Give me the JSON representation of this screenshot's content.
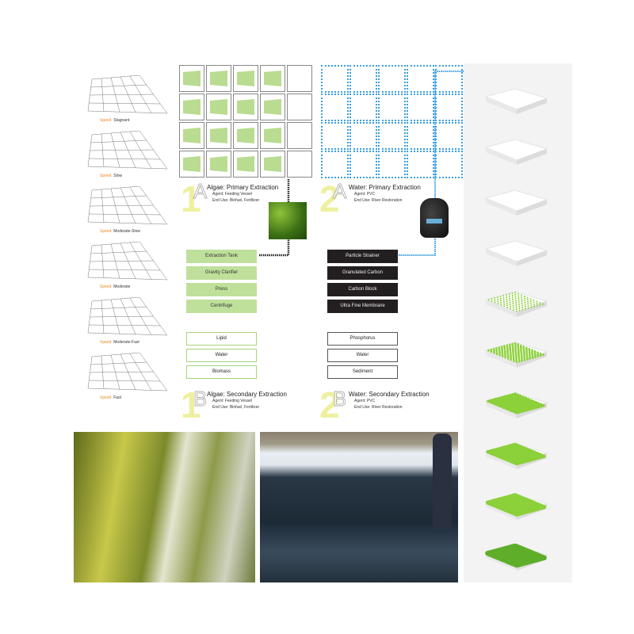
{
  "speed_models": [
    {
      "prefix": "Speed:",
      "value": "Stagnant"
    },
    {
      "prefix": "Speed:",
      "value": "Slow"
    },
    {
      "prefix": "Speed:",
      "value": "Moderate-Slow"
    },
    {
      "prefix": "Speed:",
      "value": "Moderate"
    },
    {
      "prefix": "Speed:",
      "value": "Moderate-Fast"
    },
    {
      "prefix": "Speed:",
      "value": "Fast"
    }
  ],
  "algae_primary": {
    "number": "1",
    "letter": "A",
    "title": "Algae: Primary Extraction",
    "agent": "Agent: Feeding Vessel",
    "end_use": "End Use: Biofuel, Fertilizer"
  },
  "water_primary": {
    "number": "2",
    "letter": "A",
    "title": "Water: Primary Extraction",
    "agent": "Agent: PVC",
    "end_use": "End Use: River Restoration"
  },
  "algae_process": [
    "Extraction Tank",
    "Gravity Clarifier",
    "Press",
    "Centrifuge"
  ],
  "water_process": [
    "Particle Strainer",
    "Granulated Carbon",
    "Carbon Block",
    "Ultra Fine Membrane"
  ],
  "algae_outputs": [
    "Lipid",
    "Water",
    "Biomass"
  ],
  "water_outputs": [
    "Phosphorus",
    "Water",
    "Sediment"
  ],
  "algae_secondary": {
    "number": "1",
    "letter": "B",
    "title": "Algae: Secondary Extraction",
    "agent": "Agent: Feeding Vessel",
    "end_use": "End Use: Biofuel, Fertilizer"
  },
  "water_secondary": {
    "number": "2",
    "letter": "B",
    "title": "Water: Secondary Extraction",
    "agent": "Agent: PVC",
    "end_use": "End Use: River Restoration"
  },
  "colors": {
    "algae_green": "#bfe09a",
    "water_blue": "#3a9ee0",
    "dark": "#231f20",
    "speed_orange": "#f08a24",
    "number_yellow": "#eef0a0"
  }
}
